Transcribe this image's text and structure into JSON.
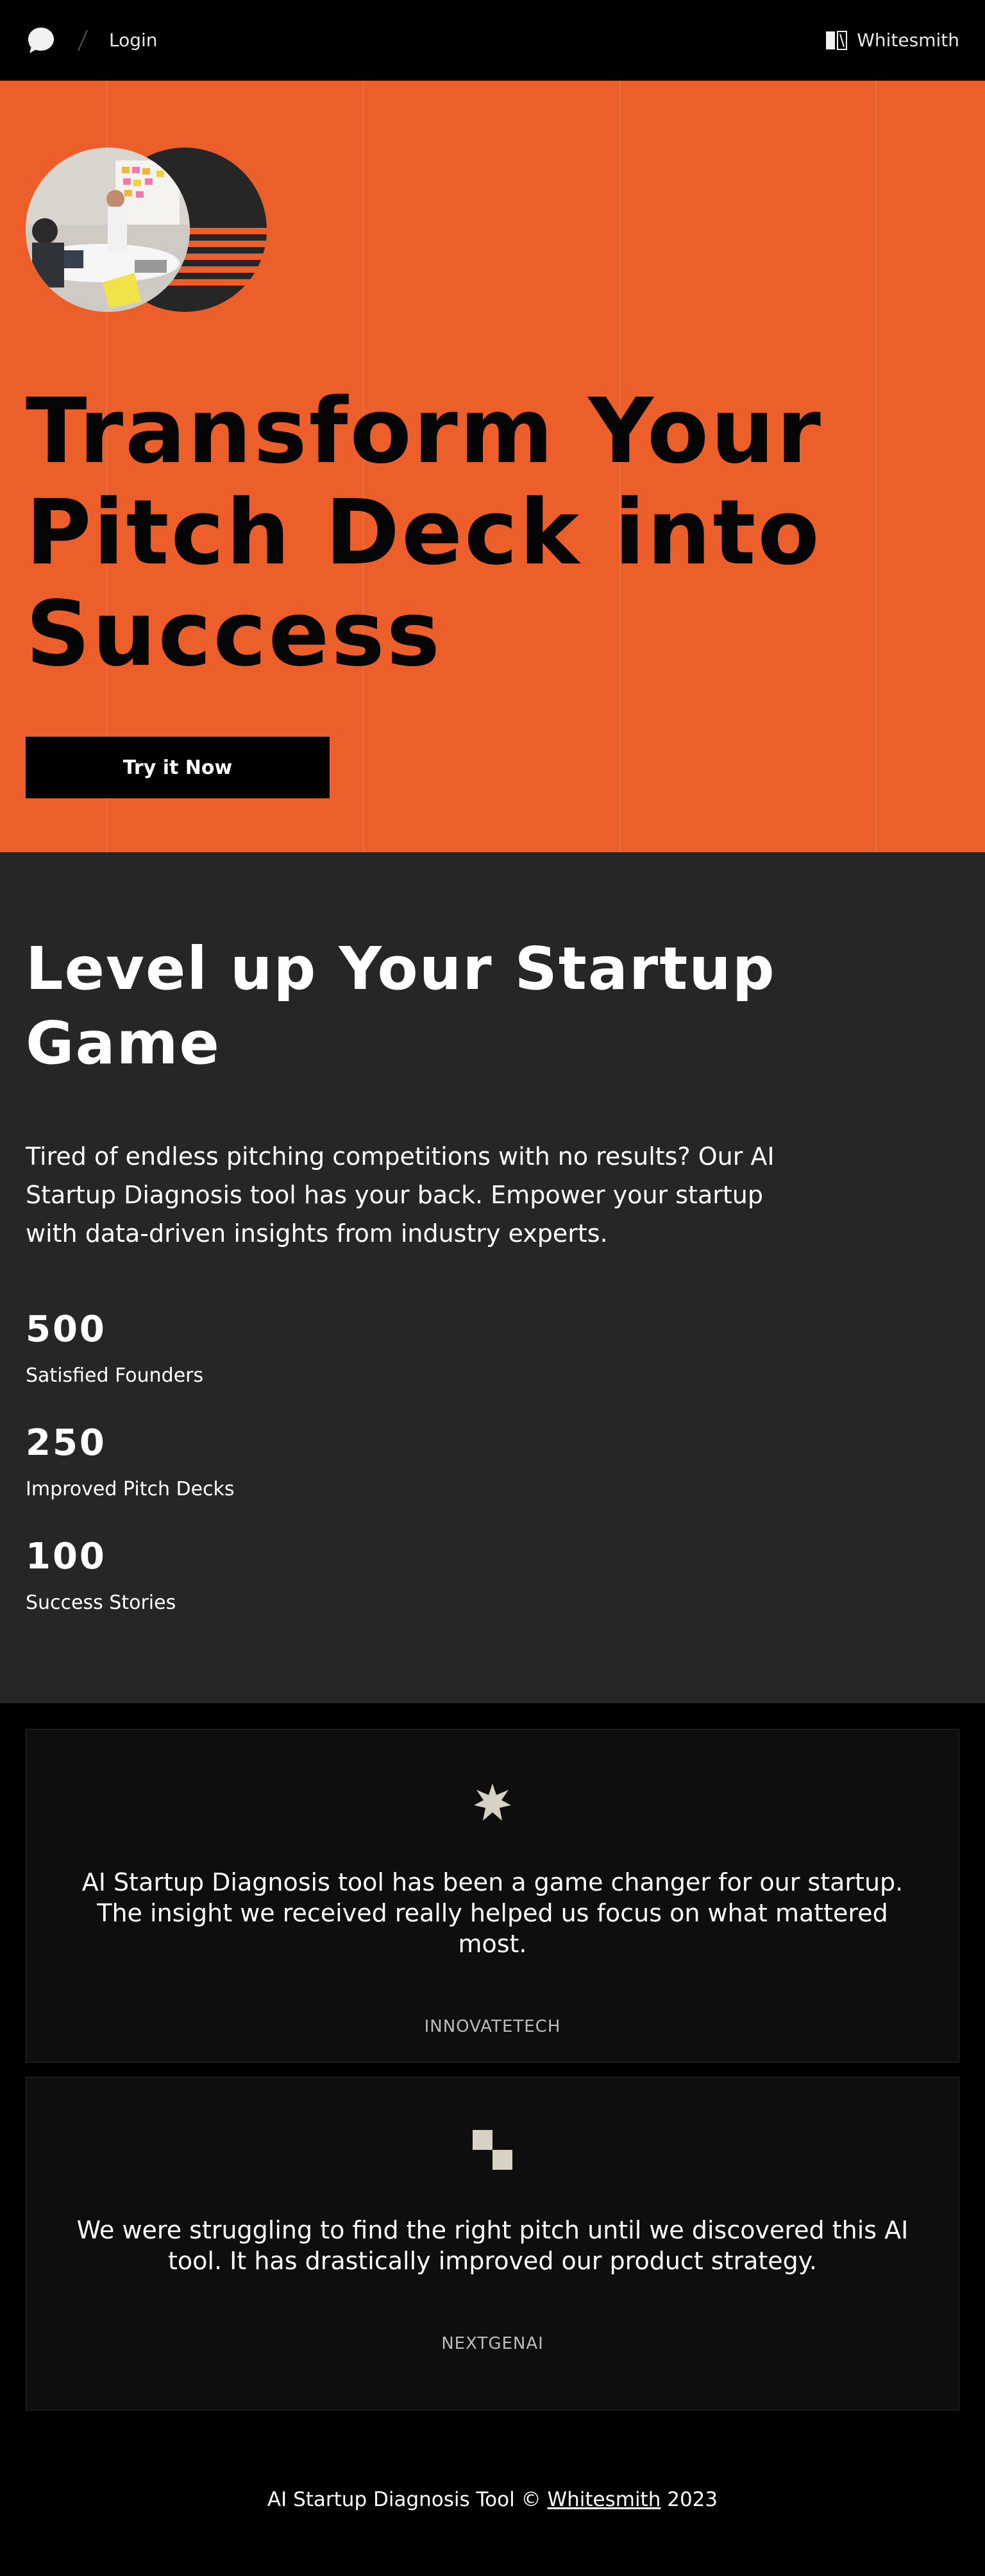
{
  "nav": {
    "login": "Login",
    "brand": "Whitesmith",
    "icons": {
      "logo": "chat-bubble-icon",
      "brand_mark": "whitesmith-logo-icon"
    }
  },
  "hero": {
    "title_lines": [
      "Transform Your",
      "Pitch Deck into",
      "Success"
    ],
    "cta": "Try it Now",
    "colors": {
      "background": "#ec5f2a",
      "text": "#050505"
    }
  },
  "stats_section": {
    "title_lines": [
      "Level up Your Startup",
      "Game"
    ],
    "body_lines": [
      "Tired of endless pitching competitions with no results? Our AI",
      "Startup Diagnosis tool has your back. Empower your startup",
      "with data-driven insights from industry experts."
    ],
    "stats": [
      {
        "number": "500",
        "label": "Satisfied Founders"
      },
      {
        "number": "250",
        "label": "Improved Pitch Decks"
      },
      {
        "number": "100",
        "label": "Success Stories"
      }
    ],
    "colors": {
      "background": "#262626"
    }
  },
  "testimonials": [
    {
      "icon": "sparkle-star-icon",
      "quote_lines": [
        "AI Startup Diagnosis tool has been a game changer for our startup.",
        "The insight we received really helped us focus on what mattered most."
      ],
      "company": "INNOVATETECH"
    },
    {
      "icon": "checker-squares-icon",
      "quote_lines": [
        "We were struggling to find the right pitch until we discovered this AI",
        "tool. It has drastically improved our product strategy."
      ],
      "company": "NEXTGENAI"
    }
  ],
  "footer": {
    "prefix": "AI Startup Diagnosis Tool ©",
    "link": "Whitesmith",
    "year": "2023"
  }
}
